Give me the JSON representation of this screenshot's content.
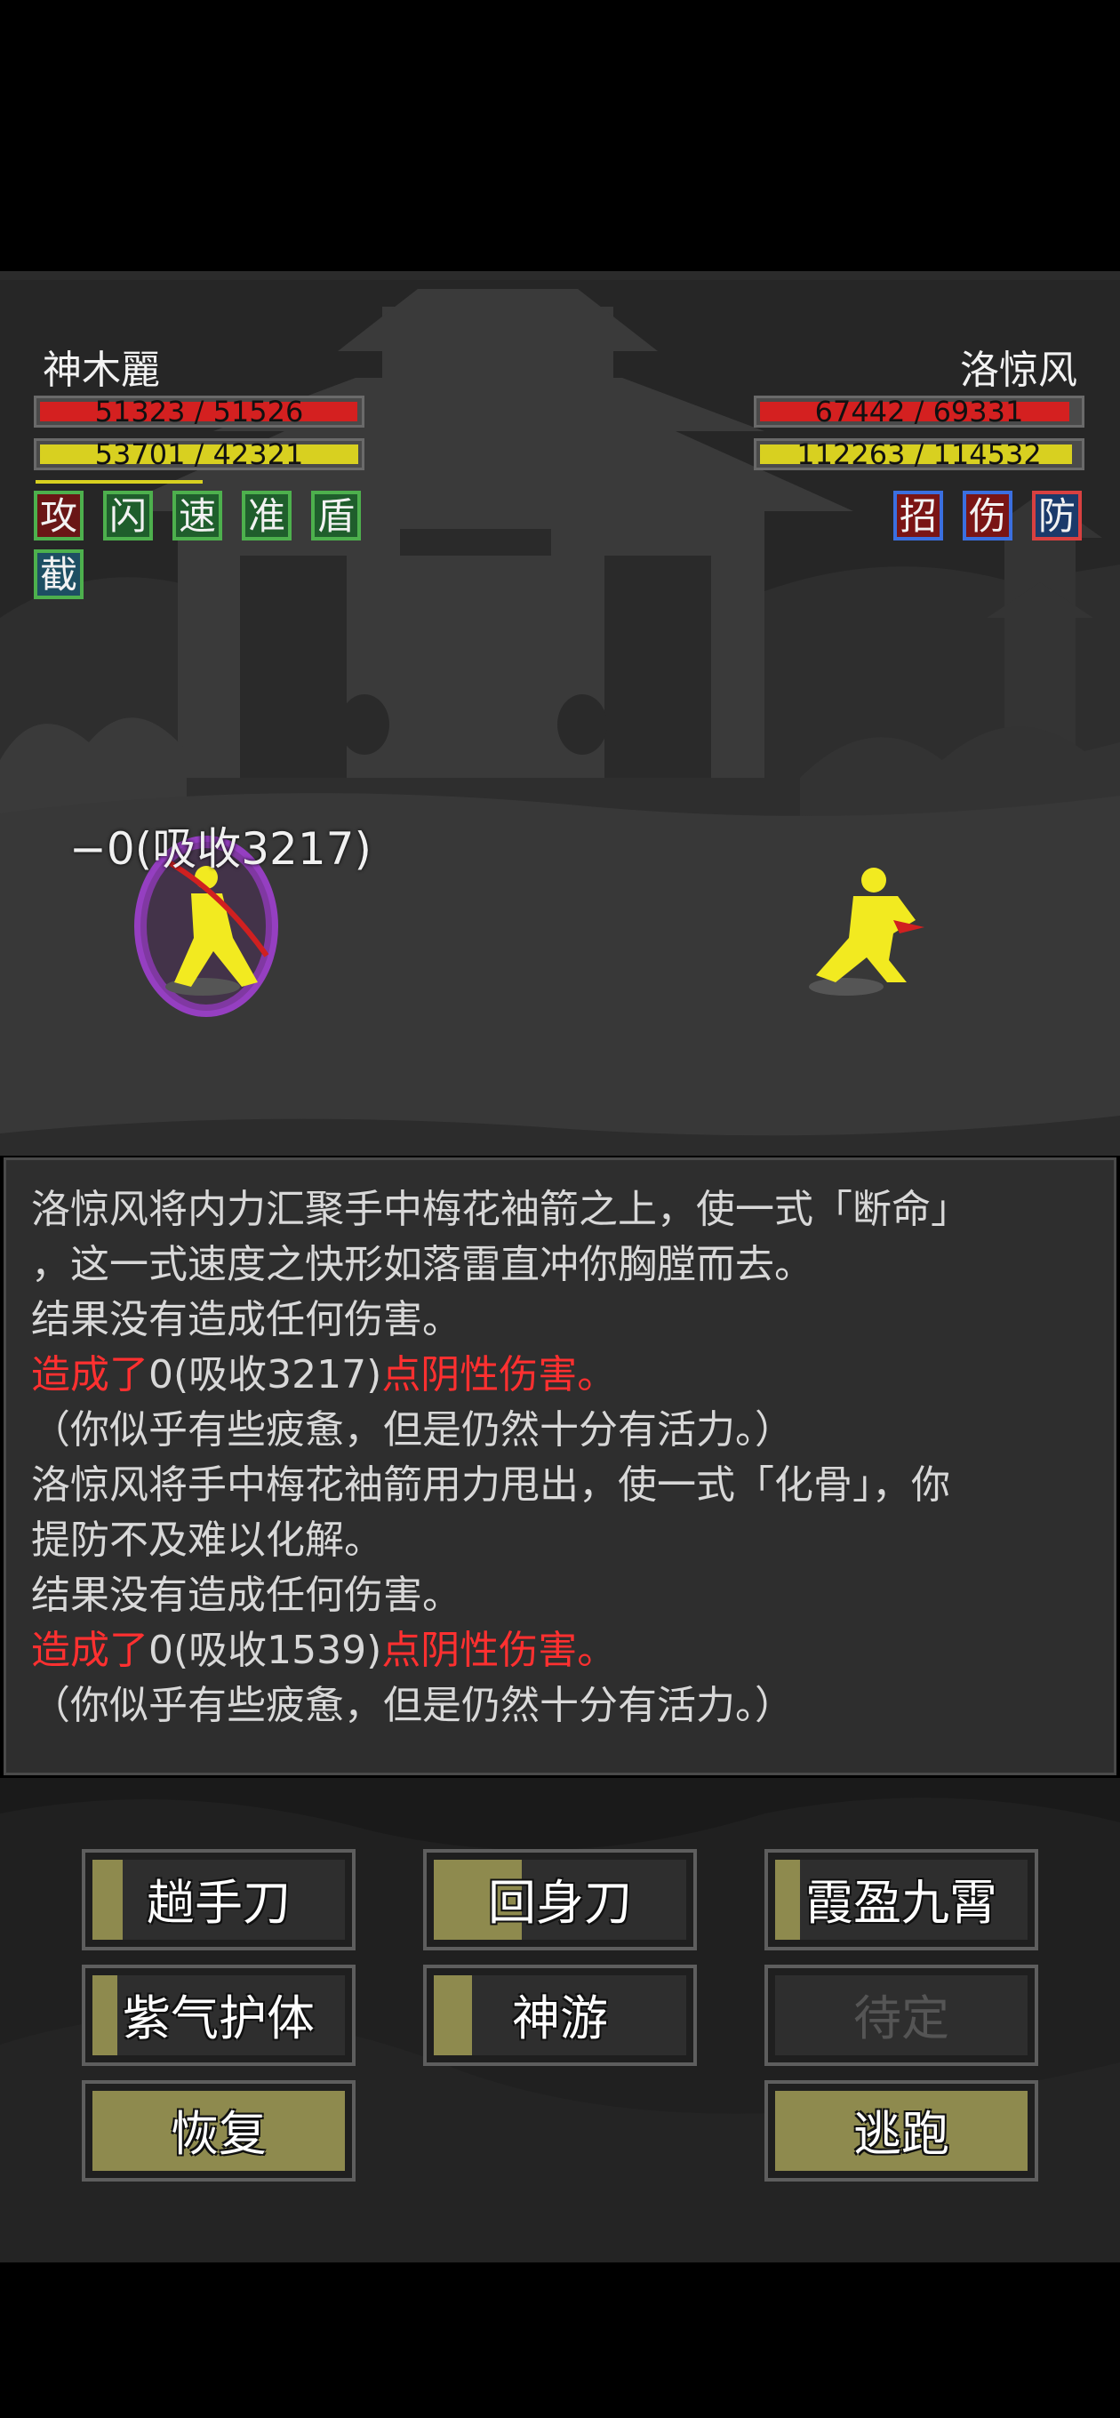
{
  "player": {
    "name": "神木麗",
    "hp_text": "51323 / 51526",
    "hp_fraction": 0.996,
    "mp_text": "53701 / 42321",
    "mp_fraction": 1.0,
    "buffs": [
      "攻",
      "闪",
      "速",
      "准",
      "盾",
      "截"
    ]
  },
  "enemy": {
    "name": "洛惊风",
    "hp_text": "67442 / 69331",
    "hp_fraction": 0.973,
    "mp_text": "112263 / 114532",
    "mp_fraction": 0.98,
    "buffs": [
      "招",
      "伤",
      "防"
    ]
  },
  "damage_popup": "−0(吸收3217)",
  "log": {
    "line1": "洛惊风将内力汇聚手中梅花袖箭之上，使一式「断命」",
    "line2": "，这一式速度之快形如落雷直冲你胸膛而去。",
    "line3": "结果没有造成任何伤害。",
    "line4_a": "造成了",
    "line4_b": "0(吸收3217)",
    "line4_c": "点阴性伤害。",
    "line5": "（你似乎有些疲惫，但是仍然十分有活力。）",
    "line6": "洛惊风将手中梅花袖箭用力甩出，使一式「化骨」，你",
    "line7": "提防不及难以化解。",
    "line8": "结果没有造成任何伤害。",
    "line9_a": "造成了",
    "line9_b": "0(吸收1539)",
    "line9_c": "点阴性伤害。",
    "line10": "（你似乎有些疲惫，但是仍然十分有活力。）"
  },
  "skills": [
    {
      "label": "趟手刀",
      "cooldown_fraction": 0.12
    },
    {
      "label": "回身刀",
      "cooldown_fraction": 0.35
    },
    {
      "label": "霞盈九霄",
      "cooldown_fraction": 0.1
    },
    {
      "label": "紫气护体",
      "cooldown_fraction": 0.1
    },
    {
      "label": "神游",
      "cooldown_fraction": 0.15
    },
    {
      "label": "待定",
      "cooldown_fraction": 0.0
    },
    {
      "label": "恢复",
      "cooldown_fraction": 1.0
    },
    {
      "label": "逃跑",
      "cooldown_fraction": 1.0
    }
  ],
  "colors": {
    "hp": "#d42020",
    "mp": "#d8d020",
    "log_damage": "#ff3030",
    "log_status": "#3cdc4c"
  }
}
